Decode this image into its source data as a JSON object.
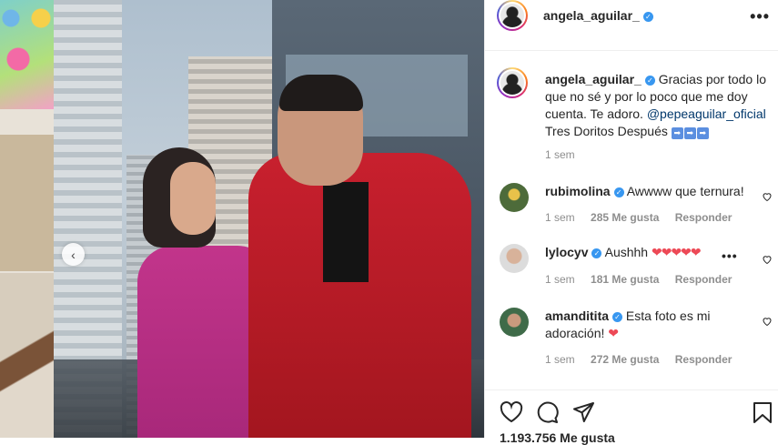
{
  "post": {
    "author": "angela_aguilar_",
    "verified_mark": "✓",
    "more_icon": "•••",
    "caption": {
      "text_before_link": "Gracias por todo lo que no sé y por lo poco que me doy cuenta. Te adoro.",
      "mention": "@pepeaguilar_oficial",
      "text_after_link": "Tres Doritos Después",
      "arrow_emojis": [
        "➡",
        "➡",
        "➡"
      ]
    },
    "time": "1 sem",
    "likes": "1.193.756 Me gusta"
  },
  "comments": [
    {
      "user": "rubimolina",
      "text": "Awwww que ternura!",
      "time": "1 sem",
      "likes": "285 Me gusta",
      "reply": "Responder"
    },
    {
      "user": "lylocyv",
      "text": "Aushhh",
      "hearts": "❤❤❤❤❤",
      "time": "1 sem",
      "likes": "181 Me gusta",
      "reply": "Responder"
    },
    {
      "user": "amanditita",
      "text": "Esta foto es mi adoración!",
      "hearts": "❤",
      "time": "1 sem",
      "likes": "272 Me gusta",
      "reply": "Responder"
    }
  ],
  "icons": {
    "carousel_prev": "‹",
    "like": "heart-outline-icon",
    "comment": "comment-bubble-icon",
    "share": "paper-plane-icon",
    "save": "bookmark-icon"
  },
  "colors": {
    "verified": "#3897f0",
    "link": "#00376b",
    "muted": "#8e8e8e",
    "heart_red": "#ed4956"
  }
}
